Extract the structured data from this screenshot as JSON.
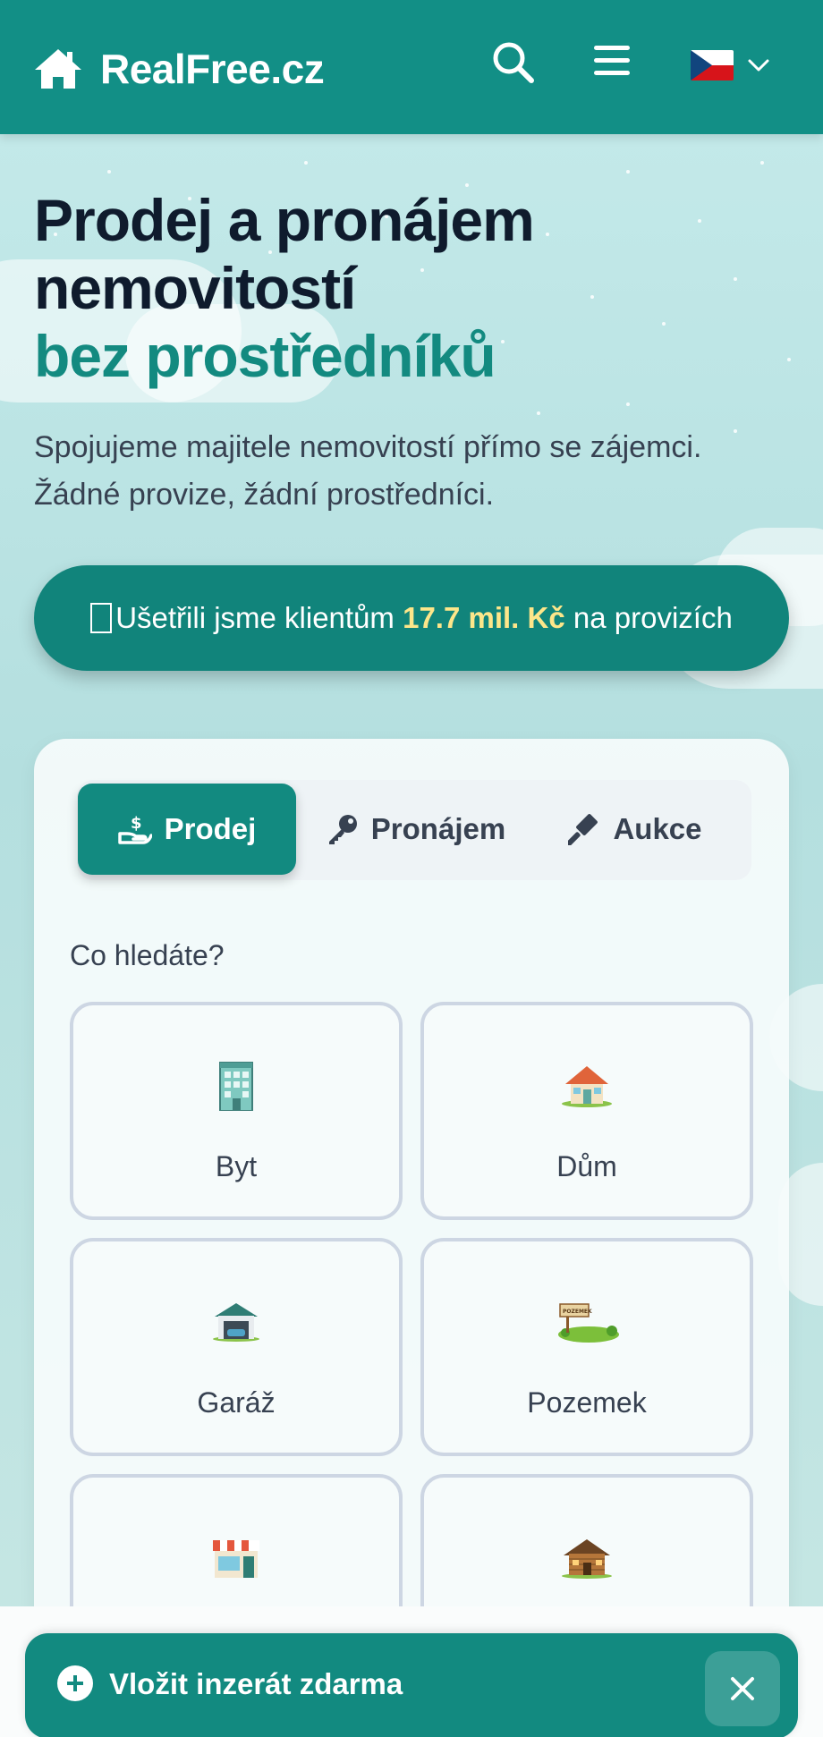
{
  "header": {
    "brand": "RealFree.cz",
    "search_icon": "search-icon",
    "menu_icon": "hamburger-menu-icon",
    "language_icon": "czech-flag-icon"
  },
  "hero": {
    "title_line1": "Prodej a pronájem",
    "title_line2": "nemovitostí",
    "title_accent": "bez prostředníků",
    "subtitle_line1": "Spojujeme majitele nemovitostí přímo se zájemci.",
    "subtitle_line2": "Žádné provize, žádní prostředníci.",
    "savings_prefix": "Ušetřili jsme klientům ",
    "savings_amount": "17.7 mil. Kč",
    "savings_suffix": " na provizích"
  },
  "search": {
    "tabs": [
      {
        "label": "Prodej",
        "icon": "hand-money-icon",
        "active": true
      },
      {
        "label": "Pronájem",
        "icon": "key-icon",
        "active": false
      },
      {
        "label": "Aukce",
        "icon": "gavel-icon",
        "active": false
      }
    ],
    "question": "Co hledáte?",
    "property_types": [
      {
        "label": "Byt",
        "icon": "apartment-building-icon"
      },
      {
        "label": "Dům",
        "icon": "house-icon"
      },
      {
        "label": "Garáž",
        "icon": "garage-icon"
      },
      {
        "label": "Pozemek",
        "icon": "land-plot-icon"
      },
      {
        "label": "",
        "icon": "shop-icon"
      },
      {
        "label": "",
        "icon": "cabin-icon"
      }
    ]
  },
  "cta": {
    "label": "Vložit inzerát zdarma",
    "close_icon": "close-icon"
  },
  "colors": {
    "brand": "#128f86",
    "accent_text": "#138a80",
    "highlight": "#fde68a"
  }
}
